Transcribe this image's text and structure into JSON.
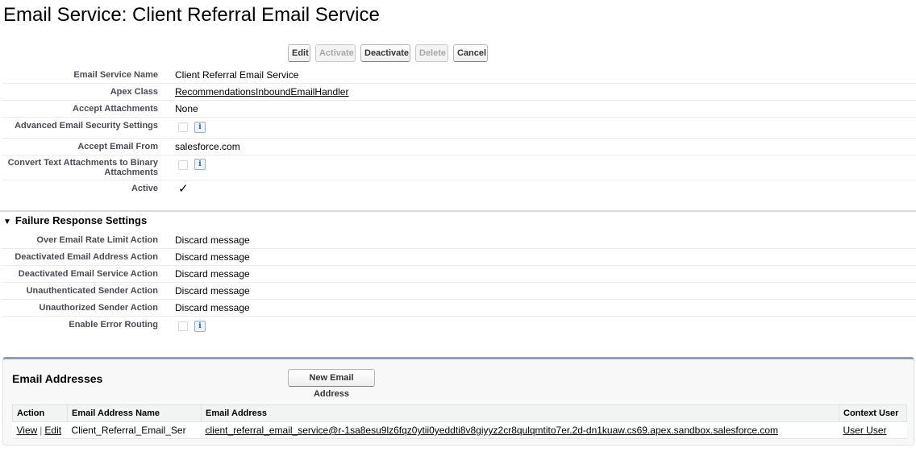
{
  "page": {
    "title": "Email Service: Client Referral Email Service"
  },
  "buttons": {
    "edit": "Edit",
    "activate": "Activate",
    "deactivate": "Deactivate",
    "delete": "Delete",
    "cancel": "Cancel"
  },
  "details": {
    "email_service_name": {
      "label": "Email Service Name",
      "value": "Client Referral Email Service"
    },
    "apex_class": {
      "label": "Apex Class",
      "value": "RecommendationsInboundEmailHandler"
    },
    "accept_attachments": {
      "label": "Accept Attachments",
      "value": "None"
    },
    "advanced_security": {
      "label": "Advanced Email Security Settings",
      "checked": false
    },
    "accept_email_from": {
      "label": "Accept Email From",
      "value": "salesforce.com"
    },
    "convert_text_attachments": {
      "label": "Convert Text Attachments to Binary Attachments",
      "checked": false
    },
    "active": {
      "label": "Active",
      "checked": true,
      "mark": "✓"
    }
  },
  "info_icon_glyph": "i",
  "failure": {
    "title": "Failure Response Settings",
    "toggle_glyph": "▼",
    "rows": [
      {
        "label": "Over Email Rate Limit Action",
        "value": "Discard message"
      },
      {
        "label": "Deactivated Email Address Action",
        "value": "Discard message"
      },
      {
        "label": "Deactivated Email Service Action",
        "value": "Discard message"
      },
      {
        "label": "Unauthenticated Sender Action",
        "value": "Discard message"
      },
      {
        "label": "Unauthorized Sender Action",
        "value": "Discard message"
      }
    ],
    "error_routing": {
      "label": "Enable Error Routing",
      "checked": false
    }
  },
  "email_addresses": {
    "title": "Email Addresses",
    "new_button": "New Email Address",
    "columns": [
      "Action",
      "Email Address Name",
      "Email Address",
      "Context User"
    ],
    "rows": [
      {
        "view": "View",
        "sep": "|",
        "edit": "Edit",
        "name": "Client_Referral_Email_Ser",
        "address": "client_referral_email_service@r-1sa8esu9lz6fqz0ytii0yeddti8v8giyyz2cr8qulqmtito7er.2d-dn1kuaw.cs69.apex.sandbox.salesforce.com",
        "context_user": "User User"
      }
    ]
  },
  "colors": {
    "label": "#4a4a56",
    "section_rule": "#d9d9d9",
    "related_list_accent": "#8a9ebe"
  }
}
